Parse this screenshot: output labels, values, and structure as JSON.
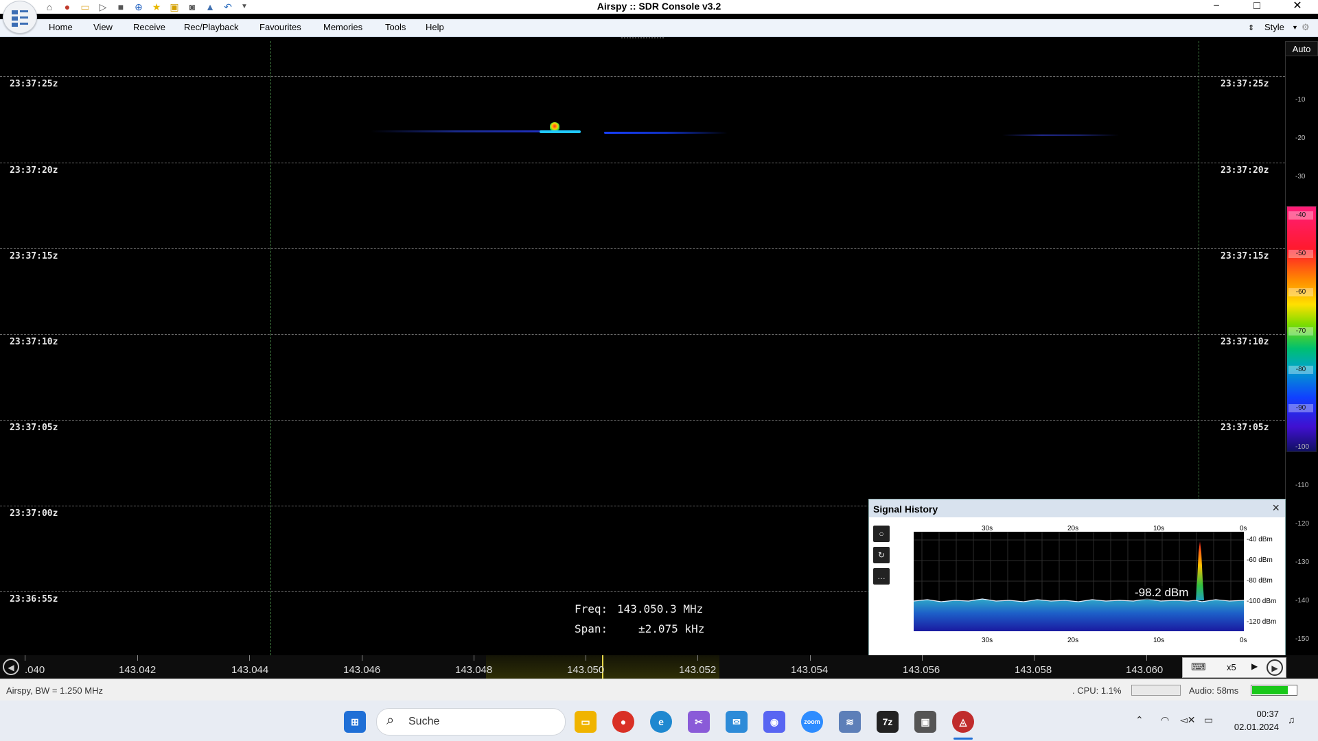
{
  "window": {
    "title": "Airspy :: SDR Console v3.2",
    "style_label": "Style",
    "quick_access_icons": [
      "home-icon",
      "record-icon",
      "folder-icon",
      "play-icon",
      "stop-icon",
      "add-icon",
      "favourite-icon",
      "lock-icon",
      "camera-icon",
      "rocket-icon",
      "undo-icon",
      "dropdown-icon"
    ]
  },
  "menu": [
    "Home",
    "View",
    "Receive",
    "Rec/Playback",
    "Favourites",
    "Memories",
    "Tools",
    "Help"
  ],
  "waterfall": {
    "time_labels": [
      "23:37:25z",
      "23:37:20z",
      "23:37:15z",
      "23:37:10z",
      "23:37:05z",
      "23:37:00z",
      "23:36:55z"
    ],
    "freq_label": "Freq:",
    "freq_value": "143.050.3 MHz",
    "span_label": "Span:",
    "span_value": "±2.075 kHz"
  },
  "level_scale": {
    "auto_label": "Auto",
    "ticks": [
      "-10",
      "-20",
      "-30",
      "-40",
      "-50",
      "-60",
      "-70",
      "-80",
      "-90",
      "-100",
      "-110",
      "-120",
      "-130",
      "-140",
      "-150"
    ]
  },
  "frequency_axis": {
    "labels": [
      ".040",
      "143.042",
      "143.044",
      "143.046",
      "143.048",
      "143.050",
      "143.052",
      "143.054",
      "143.056",
      "143.058",
      "143.060"
    ],
    "zoom": "x5"
  },
  "signal_history": {
    "title": "Signal History",
    "x_labels": [
      "30s",
      "20s",
      "10s",
      "0s"
    ],
    "y_labels": [
      "-40 dBm",
      "-60 dBm",
      "-80 dBm",
      "-100 dBm",
      "-120 dBm"
    ],
    "readout": "-98.2 dBm"
  },
  "status": {
    "left": "Airspy, BW = 1.250 MHz",
    "cpu": ". CPU: 1.1%",
    "audio": "Audio: 58ms",
    "cpu_level": 0.011,
    "audio_level": 0.8
  },
  "taskbar": {
    "search_placeholder": "Suche",
    "time": "00:37",
    "date": "02.01.2024"
  }
}
